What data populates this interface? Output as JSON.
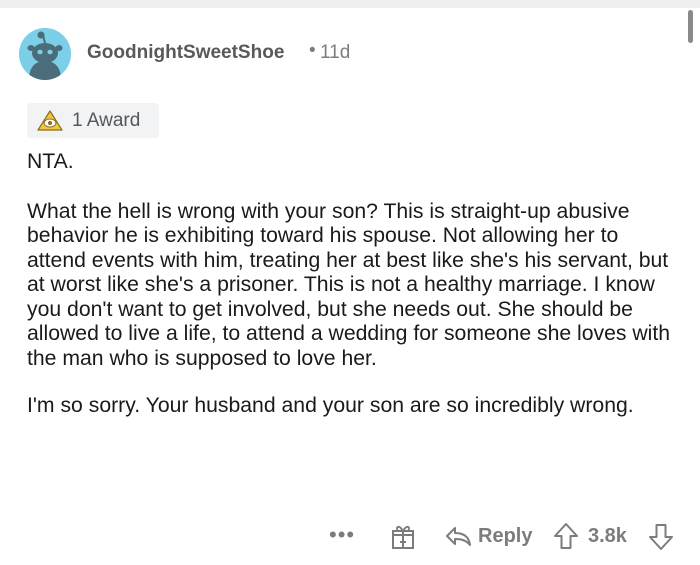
{
  "comment": {
    "username": "GoodnightSweetShoe",
    "separator": "•",
    "age": "11d",
    "award_label": "1 Award",
    "paragraphs": [
      "NTA.",
      "What the hell is wrong with your son? This is straight-up abusive behavior he is exhibiting toward his spouse. Not allowing her to attend events with him, treating her at best like she's his servant, but at worst like she's a prisoner. This is not a healthy marriage. I know you don't want to get involved, but she needs out. She should be allowed to live a life, to attend a wedding for someone she loves with the man who is supposed to love her.",
      "I'm so sorry. Your husband and your son are so incredibly wrong."
    ]
  },
  "actions": {
    "more_label": "•••",
    "reply_label": "Reply",
    "score": "3.8k"
  },
  "icons": {
    "avatar": "snoo-avatar-icon",
    "award": "award-icon",
    "gift": "gift-icon",
    "reply": "reply-arrow-icon",
    "upvote": "upvote-arrow-icon",
    "downvote": "downvote-arrow-icon"
  },
  "colors": {
    "avatar_bg": "#7bd0e7",
    "meta_text": "#7c7c7c",
    "award_bg": "#f2f3f4"
  }
}
